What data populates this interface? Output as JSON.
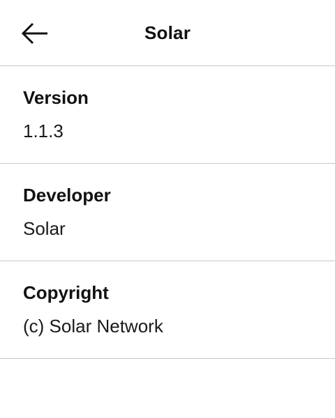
{
  "header": {
    "back_icon": "arrow-left-icon",
    "title": "Solar"
  },
  "sections": [
    {
      "label": "Version",
      "value": "1.1.3"
    },
    {
      "label": "Developer",
      "value": "Solar"
    },
    {
      "label": "Copyright",
      "value": "(c) Solar Network"
    }
  ]
}
